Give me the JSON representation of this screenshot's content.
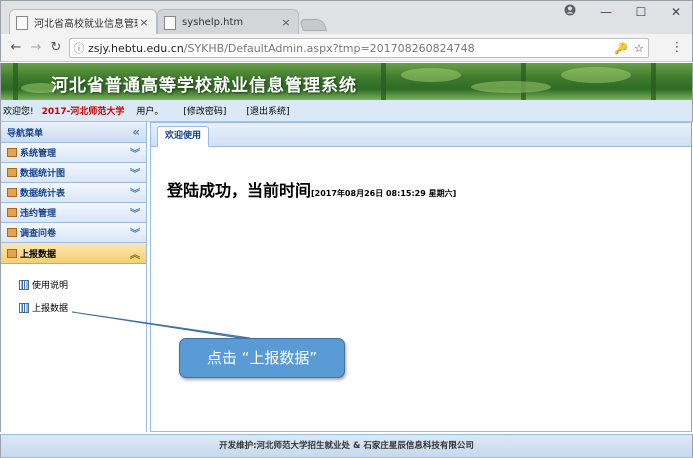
{
  "browser": {
    "tabs": [
      {
        "title": "河北省高校就业信息管理",
        "active": true
      },
      {
        "title": "syshelp.htm",
        "active": false
      }
    ],
    "url_host": "zsjy.hebtu.edu.cn",
    "url_path": "/SYKHB/DefaultAdmin.aspx?tmp=201708260824748",
    "icons": [
      "account-icon",
      "minimize-icon",
      "maximize-icon",
      "close-icon",
      "back-icon",
      "forward-icon",
      "reload-icon",
      "key-icon",
      "star-icon",
      "menu-icon"
    ]
  },
  "banner": {
    "title": "河北省普通高等学校就业信息管理系统"
  },
  "welcome": {
    "greeting": "欢迎您!",
    "school": "2017-河北师范大学",
    "user": "用户。",
    "change_password": "[修改密码]",
    "logout": "[退出系统]"
  },
  "sidebar": {
    "header": "导航菜单",
    "items": [
      {
        "label": "系统管理"
      },
      {
        "label": "数据统计图"
      },
      {
        "label": "数据统计表"
      },
      {
        "label": "违约管理"
      },
      {
        "label": "调查问卷"
      },
      {
        "label": "上报数据",
        "open": true
      }
    ],
    "sub_items": [
      {
        "label": "使用说明"
      },
      {
        "label": "上报数据"
      }
    ]
  },
  "main": {
    "tab_label": "欢迎使用",
    "success_text": "登陆成功，当前时间",
    "time_text": "[2017年08月26日 08:15:29 星期六]"
  },
  "footer": {
    "text": "开发维护:河北师范大学招生就业处 & 石家庄星辰信息科技有限公司"
  },
  "callout": {
    "text": "点击 “上报数据”"
  }
}
